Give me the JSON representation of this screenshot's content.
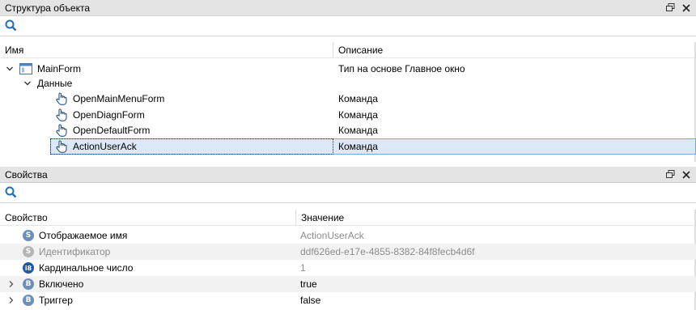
{
  "structure_panel": {
    "title": "Структура объекта",
    "columns": {
      "name": "Имя",
      "description": "Описание"
    },
    "rows": [
      {
        "name": "MainForm",
        "description": "Тип на основе Главное окно"
      },
      {
        "name": "Данные",
        "description": ""
      },
      {
        "name": "OpenMainMenuForm",
        "description": "Команда"
      },
      {
        "name": "OpenDiagnForm",
        "description": "Команда"
      },
      {
        "name": "OpenDefaultForm",
        "description": "Команда"
      },
      {
        "name": "ActionUserAck",
        "description": "Команда"
      }
    ]
  },
  "properties_panel": {
    "title": "Свойства",
    "columns": {
      "property": "Свойство",
      "value": "Значение"
    },
    "rows": [
      {
        "badge": "S",
        "name": "Отображаемое имя",
        "value": "ActionUserAck"
      },
      {
        "badge": "S",
        "name": "Идентификатор",
        "value": "ddf626ed-e17e-4855-8382-84f8fecb4d6f"
      },
      {
        "badge": "i8",
        "name": "Кардинальное число",
        "value": "1"
      },
      {
        "badge": "B",
        "name": "Включено",
        "value": "true"
      },
      {
        "badge": "B",
        "name": "Триггер",
        "value": "false"
      }
    ]
  },
  "icons": {
    "search": "search-icon",
    "restore": "restore-window-icon",
    "close": "close-icon",
    "form": "form-icon",
    "command": "hand-pointer-icon"
  },
  "colors": {
    "header_bg": "#e4e4e4",
    "selection_bg": "#dbe8f8",
    "selection_border": "#7ea6d4",
    "search_icon": "#1e6fbf",
    "badge_blue": "#3a7ecf",
    "badge_gray": "#9a9a9a",
    "badge_dark": "#1f5a9e"
  }
}
